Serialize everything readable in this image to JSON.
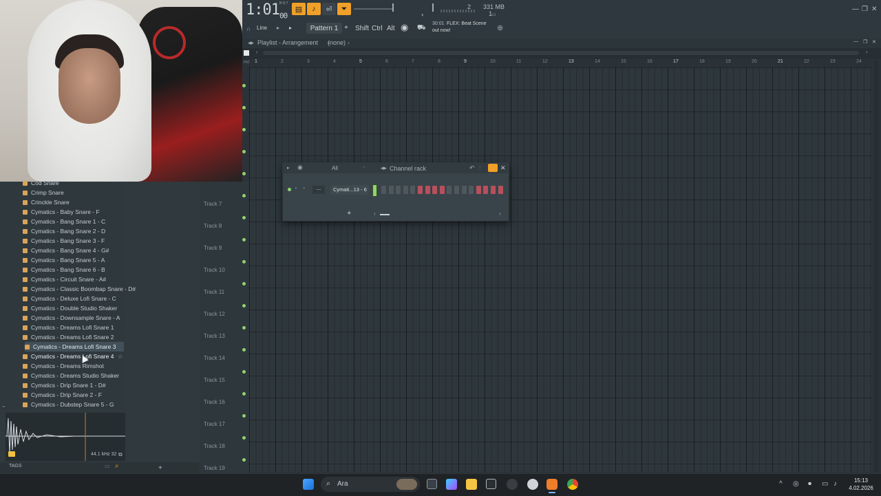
{
  "transport": {
    "time_main": "1:01",
    "time_sub": "00",
    "time_small": "B:S:T",
    "cpu_label": "2",
    "cpu_sub": "1",
    "memory": "331 MB"
  },
  "toolbar": {
    "snap_mode": "Line",
    "pattern": "Pattern 1",
    "shift": "Shift",
    "ctrl": "Ctrl",
    "alt": "Alt",
    "news_time": "30:01",
    "news_line1": "FLEX: Beat Scene",
    "news_line2": "out now!"
  },
  "playlist": {
    "title": "Playlist - Arrangement",
    "subtitle": "(none)",
    "bars": [
      "1",
      "2",
      "3",
      "4",
      "5",
      "6",
      "7",
      "8",
      "9",
      "10",
      "11",
      "12",
      "13",
      "14",
      "15",
      "16",
      "17",
      "18",
      "19",
      "20",
      "21",
      "22",
      "23",
      "24"
    ],
    "tracks": [
      "Track 7",
      "Track 8",
      "Track 9",
      "Track 10",
      "Track 11",
      "Track 12",
      "Track 13",
      "Track 14",
      "Track 15",
      "Track 16",
      "Track 17",
      "Track 18",
      "Track 19"
    ]
  },
  "channel_rack": {
    "title": "Channel rack",
    "filter": "All",
    "channel_name": "Cymati...13 - 6",
    "steps": [
      0,
      0,
      0,
      0,
      0,
      1,
      1,
      1,
      1,
      0,
      0,
      0,
      0,
      1,
      1,
      1,
      1
    ],
    "add_label": "+"
  },
  "browser": {
    "items": [
      "Cod Snare",
      "Crimp Snare",
      "Crinckle Snare",
      "Cymatics - Baby Snare - F",
      "Cymatics - Bang Snare 1 - C",
      "Cymatics - Bang Snare 2 - D",
      "Cymatics - Bang Snare 3 - F",
      "Cymatics - Bang Snare 4 - G#",
      "Cymatics - Bang Snare 5 - A",
      "Cymatics - Bang Snare 6 - B",
      "Cymatics - Circuit Snare - A#",
      "Cymatics - Classic Boombap Snare - D#",
      "Cymatics - Deluxe Lofi Snare - C",
      "Cymatics - Double Studio Shaker",
      "Cymatics - Downsample Snare - A",
      "Cymatics - Dreams Lofi Snare 1",
      "Cymatics - Dreams Lofi Snare 2",
      "Cymatics - Dreams Lofi Snare 3",
      "Cymatics - Dreams Lofi Snare 4",
      "Cymatics - Dreams Rimshot",
      "Cymatics - Dreams Studio Shaker",
      "Cymatics - Drip Snare 1 - D#",
      "Cymatics - Drip Snare 2 - F",
      "Cymatics - Dubstep Snare 5 - G"
    ],
    "selected_index": 17,
    "hover_index": 18,
    "sample_info": "44.1 kHz 32",
    "tags_label": "TAGS"
  },
  "taskbar": {
    "search_placeholder": "Ara",
    "time": "15:13",
    "date": "4.02.2026"
  },
  "colors": {
    "accent": "#f0a028",
    "led": "#8fd46e",
    "step_red": "#b8505c"
  }
}
